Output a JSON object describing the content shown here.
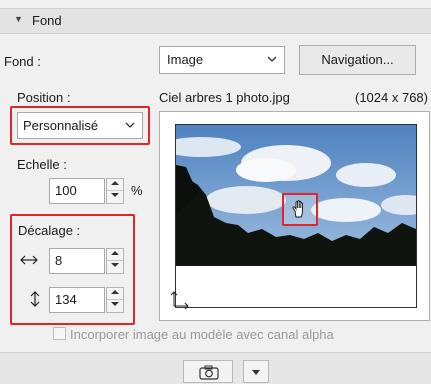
{
  "section": {
    "title": "Fond"
  },
  "fond": {
    "label": "Fond :",
    "select_value": "Image",
    "navigation_button": "Navigation..."
  },
  "image_info": {
    "filename": "Ciel arbres 1 photo.jpg",
    "dimensions": "(1024 x 768)"
  },
  "position": {
    "label": "Position :",
    "select_value": "Personnalisé"
  },
  "echelle": {
    "label": "Echelle :",
    "value": "100",
    "unit": "%"
  },
  "decalage": {
    "label": "Décalage :",
    "horizontal_value": "8",
    "vertical_value": "134"
  },
  "alpha_checkbox": {
    "label": "Incorporer image au modèle avec canal alpha",
    "checked": false
  },
  "colors": {
    "highlight": "#e0262b",
    "panel_bg": "#f0f0f0",
    "sky": "#5f8fc7"
  },
  "icons": [
    "triangle-down-icon",
    "chevron-down-icon",
    "horizontal-arrows-icon",
    "vertical-arrows-icon",
    "hand-cursor-icon",
    "camera-icon"
  ]
}
